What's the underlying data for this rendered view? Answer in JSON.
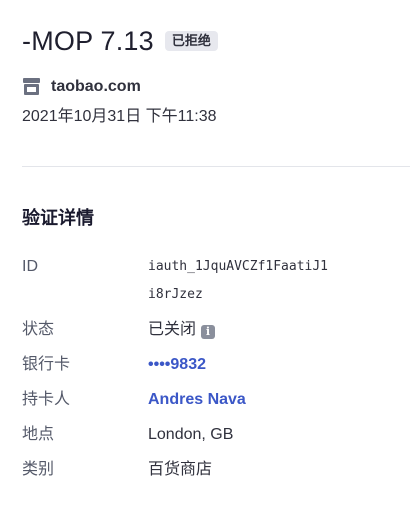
{
  "header": {
    "amount": "-MOP 7.13",
    "status": "已拒绝"
  },
  "merchant": {
    "icon": "store-icon",
    "name": "taobao.com"
  },
  "timestamp": "2021年10月31日 下午11:38",
  "details": {
    "title": "验证详情",
    "id_label": "ID",
    "id_value": "iauth_1JquAVCZf1FaatiJ1i8rJzez",
    "status_label": "状态",
    "status_value": "已关闭",
    "status_info_icon": "info-icon",
    "card_label": "银行卡",
    "card_value": "••••9832",
    "holder_label": "持卡人",
    "holder_value": "Andres Nava",
    "location_label": "地点",
    "location_value": "London, GB",
    "category_label": "类别",
    "category_value": "百货商店"
  },
  "colors": {
    "link": "#3b57c7",
    "badge_bg": "#e7e8ee",
    "text": "#30313d"
  }
}
